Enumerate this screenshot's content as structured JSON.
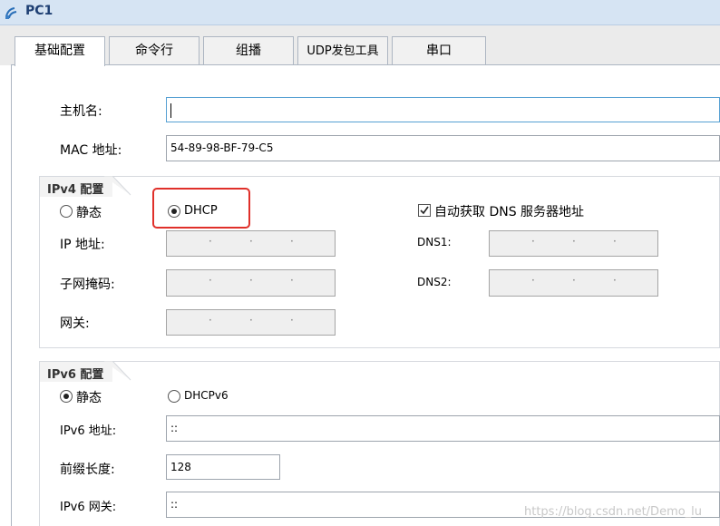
{
  "window": {
    "title": "PC1"
  },
  "tabs": [
    {
      "label": "基础配置",
      "active": true
    },
    {
      "label": "命令行"
    },
    {
      "label": "组播"
    },
    {
      "label": "UDP发包工具"
    },
    {
      "label": "串口"
    }
  ],
  "basic": {
    "hostname_label": "主机名:",
    "hostname_value": "",
    "mac_label": "MAC 地址:",
    "mac_value": "54-89-98-BF-79-C5"
  },
  "ipv4": {
    "title": "IPv4 配置",
    "static_label": "静态",
    "dhcp_label": "DHCP",
    "selected": "DHCP",
    "auto_dns_label": "自动获取 DNS 服务器地址",
    "auto_dns_checked": true,
    "ip_label": "IP 地址:",
    "mask_label": "子网掩码:",
    "gateway_label": "网关:",
    "dns1_label": "DNS1:",
    "dns2_label": "DNS2:",
    "ip_dots": "·",
    "highlight_color": "#e0302a"
  },
  "ipv6": {
    "title": "IPv6 配置",
    "static_label": "静态",
    "dhcp_label": "DHCPv6",
    "selected": "静态",
    "ip_label": "IPv6 地址:",
    "ip_value": "::",
    "prefix_label": "前缀长度:",
    "prefix_value": "128",
    "gateway_label": "IPv6 网关:",
    "gateway_value": "::"
  },
  "watermark": "https://blog.csdn.net/Demo_lu"
}
